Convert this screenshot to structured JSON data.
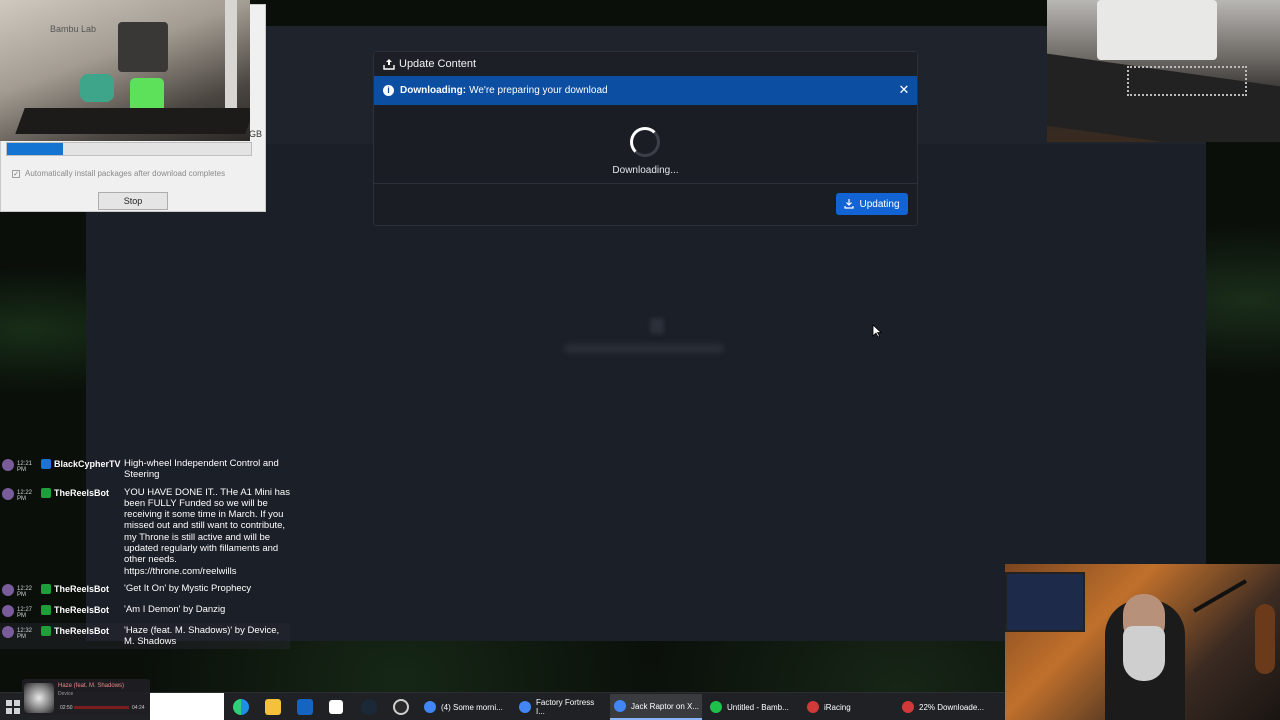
{
  "dialog": {
    "title": "Update Content",
    "alert_strong": "Downloading:",
    "alert_text": "We're preparing your download",
    "status_text": "Downloading...",
    "button_label": "Updating"
  },
  "download_window": {
    "size_suffix": "GB",
    "progress_fraction": 0.23,
    "checkbox_label": "Automatically install packages after download completes",
    "stop_label": "Stop"
  },
  "camera": {
    "printer_brand": "Bambu Lab"
  },
  "chat": {
    "messages": [
      {
        "time": "12:21 PM",
        "user": "BlackCypherTV",
        "text": "High-wheel Independent Control and Steering",
        "badge": "blue"
      },
      {
        "time": "12:22 PM",
        "user": "TheReelsBot",
        "text": "YOU HAVE DONE IT.. THe A1 Mini has been FULLY Funded so we will be receiving it some time in March. If you missed out and still want to contribute, my Throne is still active and will be updated regularly with fillaments and other needs. https://throne.com/reelwills",
        "badge": "green"
      },
      {
        "time": "12:22 PM",
        "user": "TheReelsBot",
        "text": "'Get It On' by Mystic Prophecy",
        "badge": "green"
      },
      {
        "time": "12:27 PM",
        "user": "TheReelsBot",
        "text": "'Am I Demon' by Danzig",
        "badge": "green"
      },
      {
        "time": "12:32 PM",
        "user": "TheReelsBot",
        "text": "'Haze (feat. M. Shadows)' by Device, M. Shadows",
        "badge": "green"
      }
    ]
  },
  "media": {
    "title": "Haze (feat. M. Shadows)",
    "subtitle": "Device",
    "time_current": "02:50",
    "time_total": "04:24",
    "progress_fraction": 0.65
  },
  "taskbar": {
    "tasks": [
      {
        "label": "(4) Some morni...",
        "icon_color": "#4285f4"
      },
      {
        "label": "Factory Fortress I...",
        "icon_color": "#4285f4"
      },
      {
        "label": "Jack Raptor on X...",
        "icon_color": "#4285f4",
        "active": true
      },
      {
        "label": "Untitled - Bamb...",
        "icon_color": "#1fbf4c"
      },
      {
        "label": "iRacing",
        "icon_color": "#d23a3a"
      },
      {
        "label": "22% Downloade...",
        "icon_color": "#d23a3a"
      }
    ]
  },
  "colors": {
    "alert_blue": "#0b4ea2",
    "button_blue": "#1264d4",
    "progress_blue": "#1474d1"
  }
}
